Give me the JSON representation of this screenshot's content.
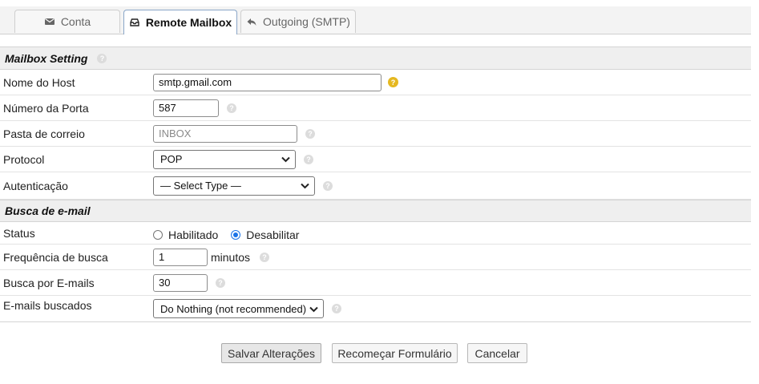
{
  "tabs": [
    {
      "label": "Conta",
      "icon": "envelope-icon"
    },
    {
      "label": "Remote Mailbox",
      "icon": "inbox-icon"
    },
    {
      "label": "Outgoing (SMTP)",
      "icon": "reply-icon"
    }
  ],
  "sections": {
    "mailbox": "Mailbox Setting",
    "fetch": "Busca de e-mail"
  },
  "fields": {
    "host": {
      "label": "Nome do Host",
      "value": "smtp.gmail.com"
    },
    "port": {
      "label": "Número da Porta",
      "value": "587"
    },
    "folder": {
      "label": "Pasta de correio",
      "placeholder": "INBOX"
    },
    "protocol": {
      "label": "Protocol",
      "selected": "POP"
    },
    "auth": {
      "label": "Autenticação",
      "selected": "— Select Type —"
    },
    "status": {
      "label": "Status",
      "options": [
        "Habilitado",
        "Desabilitar"
      ],
      "selected": "Desabilitar"
    },
    "frequency": {
      "label": "Frequência de busca",
      "value": "1",
      "unit": "minutos"
    },
    "count": {
      "label": "Busca por E-mails",
      "value": "30"
    },
    "fetched": {
      "label": "E-mails buscados",
      "selected": "Do Nothing (not recommended)"
    }
  },
  "buttons": {
    "save": "Salvar Alterações",
    "reset": "Recomeçar Formulário",
    "cancel": "Cancelar"
  },
  "colors": {
    "accent": "#1a73e8",
    "help_active": "#e5b820"
  }
}
